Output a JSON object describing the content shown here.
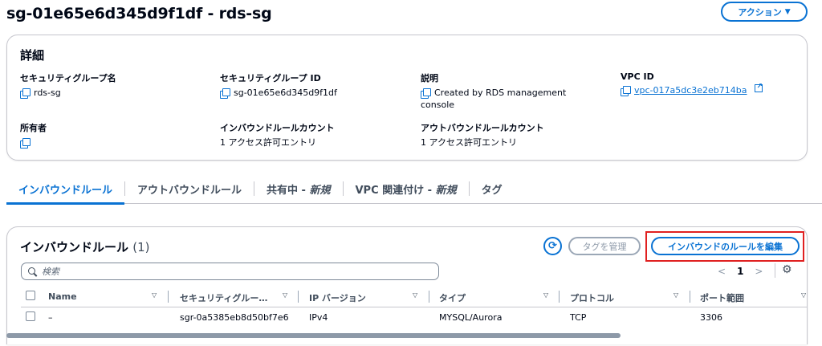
{
  "header": {
    "title": "sg-01e65e6d345d9f1df - rds-sg",
    "actions_label": "アクション",
    "actions_caret": "▼"
  },
  "details": {
    "title": "詳細",
    "sg_name": {
      "label": "セキュリティグループ名",
      "value": "rds-sg"
    },
    "sg_id": {
      "label": "セキュリティグループ ID",
      "value": "sg-01e65e6d345d9f1df"
    },
    "description": {
      "label": "説明",
      "value_line1": "Created by RDS management",
      "value_line2": "console"
    },
    "vpc_id": {
      "label": "VPC ID",
      "value": "vpc-017a5dc3e2eb714ba"
    },
    "owner": {
      "label": "所有者",
      "value": ""
    },
    "inbound_count": {
      "label": "インバウンドルールカウント",
      "value": "1 アクセス許可エントリ"
    },
    "outbound_count": {
      "label": "アウトバウンドルールカウント",
      "value": "1 アクセス許可エントリ"
    }
  },
  "tabs": [
    {
      "label": "インバウンドルール",
      "suffix": "",
      "active": true
    },
    {
      "label": "アウトバウンドルール",
      "suffix": "",
      "active": false
    },
    {
      "label": "共有中 - ",
      "suffix": "新規",
      "active": false
    },
    {
      "label": "VPC 関連付け - ",
      "suffix": "新規",
      "active": false
    },
    {
      "label": "タグ",
      "suffix": "",
      "active": false
    }
  ],
  "rules": {
    "title": "インバウンドルール",
    "count": "(1)",
    "refresh_glyph": "⟳",
    "manage_tags_label": "タグを管理",
    "edit_label": "インバウンドのルールを編集",
    "search_placeholder": "検索",
    "pager": {
      "prev": "<",
      "page": "1",
      "next": ">"
    },
    "columns": [
      "Name",
      "セキュリティグルー…",
      "IP バージョン",
      "タイプ",
      "プロトコル",
      "ポート範囲"
    ],
    "sort_glyph": "▽",
    "row": {
      "name": "–",
      "rule_id": "sgr-0a5385eb8d50bf7e6",
      "ip_version": "IPv4",
      "type": "MYSQL/Aurora",
      "protocol": "TCP",
      "port_range": "3306"
    }
  },
  "colors": {
    "accent": "#0972d3",
    "highlight_border": "#e02020",
    "border": "#c6c6cd",
    "text": "#000716"
  }
}
